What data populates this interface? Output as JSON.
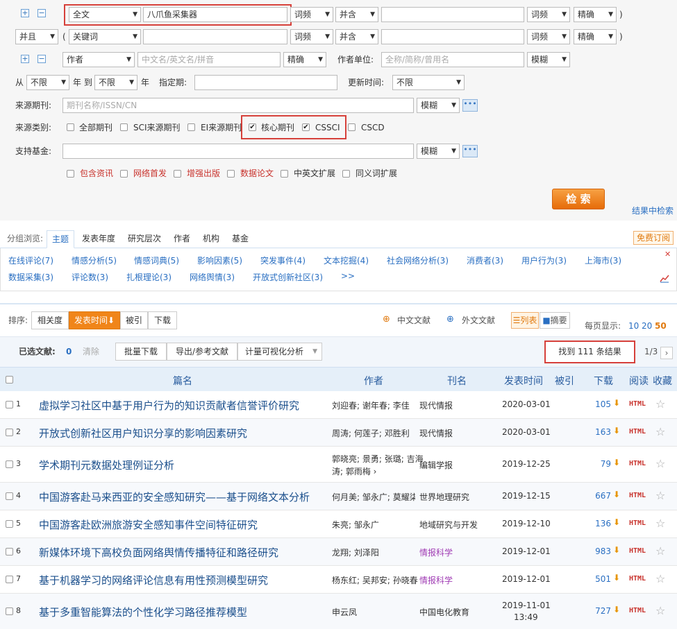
{
  "search": {
    "row1": {
      "field": "全文",
      "value": "八爪鱼采集器",
      "freq": "词频",
      "op": "并含",
      "value2": "",
      "freq2": "词频",
      "match": "精确",
      "close": ")"
    },
    "row2": {
      "logic": "并且",
      "open": "(",
      "field": "关键词",
      "value": "",
      "freq": "词频",
      "op": "并含",
      "value2": "",
      "freq2": "词频",
      "match": "精确",
      "close": ")"
    },
    "row3": {
      "field": "作者",
      "placeholder": "中文名/英文名/拼音",
      "match": "精确",
      "org_label": "作者单位:",
      "org_placeholder": "全称/简称/曾用名",
      "org_match": "模糊"
    },
    "row4": {
      "from": "从",
      "from_year": "不限",
      "year_to": "年 到",
      "to_year": "不限",
      "year": "年",
      "period_label": "指定期:",
      "update_label": "更新时间:",
      "update_value": "不限"
    },
    "row5": {
      "label": "来源期刊:",
      "placeholder": "期刊名称/ISSN/CN",
      "match": "模糊",
      "dots": "•••"
    },
    "row6": {
      "label": "来源类别:",
      "options": [
        {
          "label": "全部期刊",
          "checked": false
        },
        {
          "label": "SCI来源期刊",
          "checked": false
        },
        {
          "label": "EI来源期刊",
          "checked": false
        },
        {
          "label": "核心期刊",
          "checked": true
        },
        {
          "label": "CSSCI",
          "checked": true
        },
        {
          "label": "CSCD",
          "checked": false
        }
      ]
    },
    "row7": {
      "label": "支持基金:",
      "match": "模糊",
      "dots": "•••"
    },
    "row8": {
      "options": [
        "包含资讯",
        "网络首发",
        "增强出版",
        "数据论文",
        "中英文扩展",
        "同义词扩展"
      ]
    },
    "search_button": "检 索",
    "in_results": "结果中检索",
    "plus": "+",
    "minus": "−",
    "check": "✔"
  },
  "group": {
    "label": "分组浏览:",
    "tabs": [
      "主题",
      "发表年度",
      "研究层次",
      "作者",
      "机构",
      "基金"
    ],
    "subscribe": "免费订阅",
    "close": "✕",
    "topics_row1": [
      "在线评论(7)",
      "情感分析(5)",
      "情感词典(5)",
      "影响因素(5)",
      "突发事件(4)",
      "文本挖掘(4)",
      "社会网络分析(3)",
      "消费者(3)",
      "用户行为(3)",
      "上海市(3)"
    ],
    "topics_row2": [
      "数据采集(3)",
      "评论数(3)",
      "扎根理论(3)",
      "网络舆情(3)",
      "开放式创新社区(3)",
      ">>"
    ]
  },
  "sortbar": {
    "label": "排序:",
    "options": [
      "相关度",
      "发表时间⬇",
      "被引",
      "下载"
    ],
    "cn_docs": "中文文献",
    "foreign_docs": "外文文献",
    "list_view": "列表",
    "abstract_view": "摘要",
    "per_page_label": "每页显示:",
    "per_page": [
      "10",
      "20",
      "50"
    ]
  },
  "selbar": {
    "selected_label": "已选文献:",
    "selected_count": "0",
    "clear": "清除",
    "batch_download": "批量下载",
    "export": "导出/参考文献",
    "analysis": "计量可视化分析",
    "found": "找到 111 条结果",
    "page": "1/3",
    "next": "›"
  },
  "table": {
    "headers": {
      "title": "篇名",
      "author": "作者",
      "source": "刊名",
      "date": "发表时间",
      "cited": "被引",
      "download": "下载",
      "read": "阅读",
      "fav": "收藏"
    },
    "html_label": "HTML",
    "star": "☆",
    "dl_icon": "⬇",
    "rows": [
      {
        "n": "1",
        "title": "虚拟学习社区中基于用户行为的知识贡献者信誉评价研究",
        "author": "刘迎春; 谢年春; 李佳",
        "source": "现代情报",
        "date": "2020-03-01",
        "time": "",
        "downloads": "105"
      },
      {
        "n": "2",
        "title": "开放式创新社区用户知识分享的影响因素研究",
        "author": "周涛; 何莲子; 邓胜利",
        "source": "现代情报",
        "date": "2020-03-01",
        "time": "",
        "downloads": "163"
      },
      {
        "n": "3",
        "title": "学术期刊元数据处理例证分析",
        "author": "郭晓亮; 景勇; 张璐; 吉海",
        "author2": "涛; 郭雨梅 ›",
        "source": "编辑学报",
        "date": "2019-12-25",
        "time": "",
        "downloads": "79"
      },
      {
        "n": "4",
        "title": "中国游客赴马来西亚的安全感知研究——基于网络文本分析",
        "author": "何月美; 邹永广; 莫耀柒",
        "source": "世界地理研究",
        "date": "2019-12-15",
        "time": "",
        "downloads": "667"
      },
      {
        "n": "5",
        "title": "中国游客赴欧洲旅游安全感知事件空间特征研究",
        "author": "朱亮; 邹永广",
        "source": "地域研究与开发",
        "date": "2019-12-10",
        "time": "",
        "downloads": "136"
      },
      {
        "n": "6",
        "title": "新媒体环境下高校负面网络舆情传播特征和路径研究",
        "author": "龙翔; 刘泽阳",
        "source": "情报科学",
        "date": "2019-12-01",
        "time": "",
        "downloads": "983"
      },
      {
        "n": "7",
        "title": "基于机器学习的网络评论信息有用性预测模型研究",
        "author": "杨东红; 吴邦安; 孙晓春",
        "source": "情报科学",
        "date": "2019-12-01",
        "time": "",
        "downloads": "501"
      },
      {
        "n": "8",
        "title": "基于多重智能算法的个性化学习路径推荐模型",
        "author": "申云凤",
        "source": "中国电化教育",
        "date": "2019-11-01",
        "time": "13:49",
        "downloads": "727"
      }
    ]
  },
  "colors": {
    "accent_orange": "#f08519",
    "link_blue": "#2a6fc2",
    "title_blue": "#1b4f8c",
    "highlight_red": "#d6403a",
    "purple_source": "#a03cb4"
  }
}
